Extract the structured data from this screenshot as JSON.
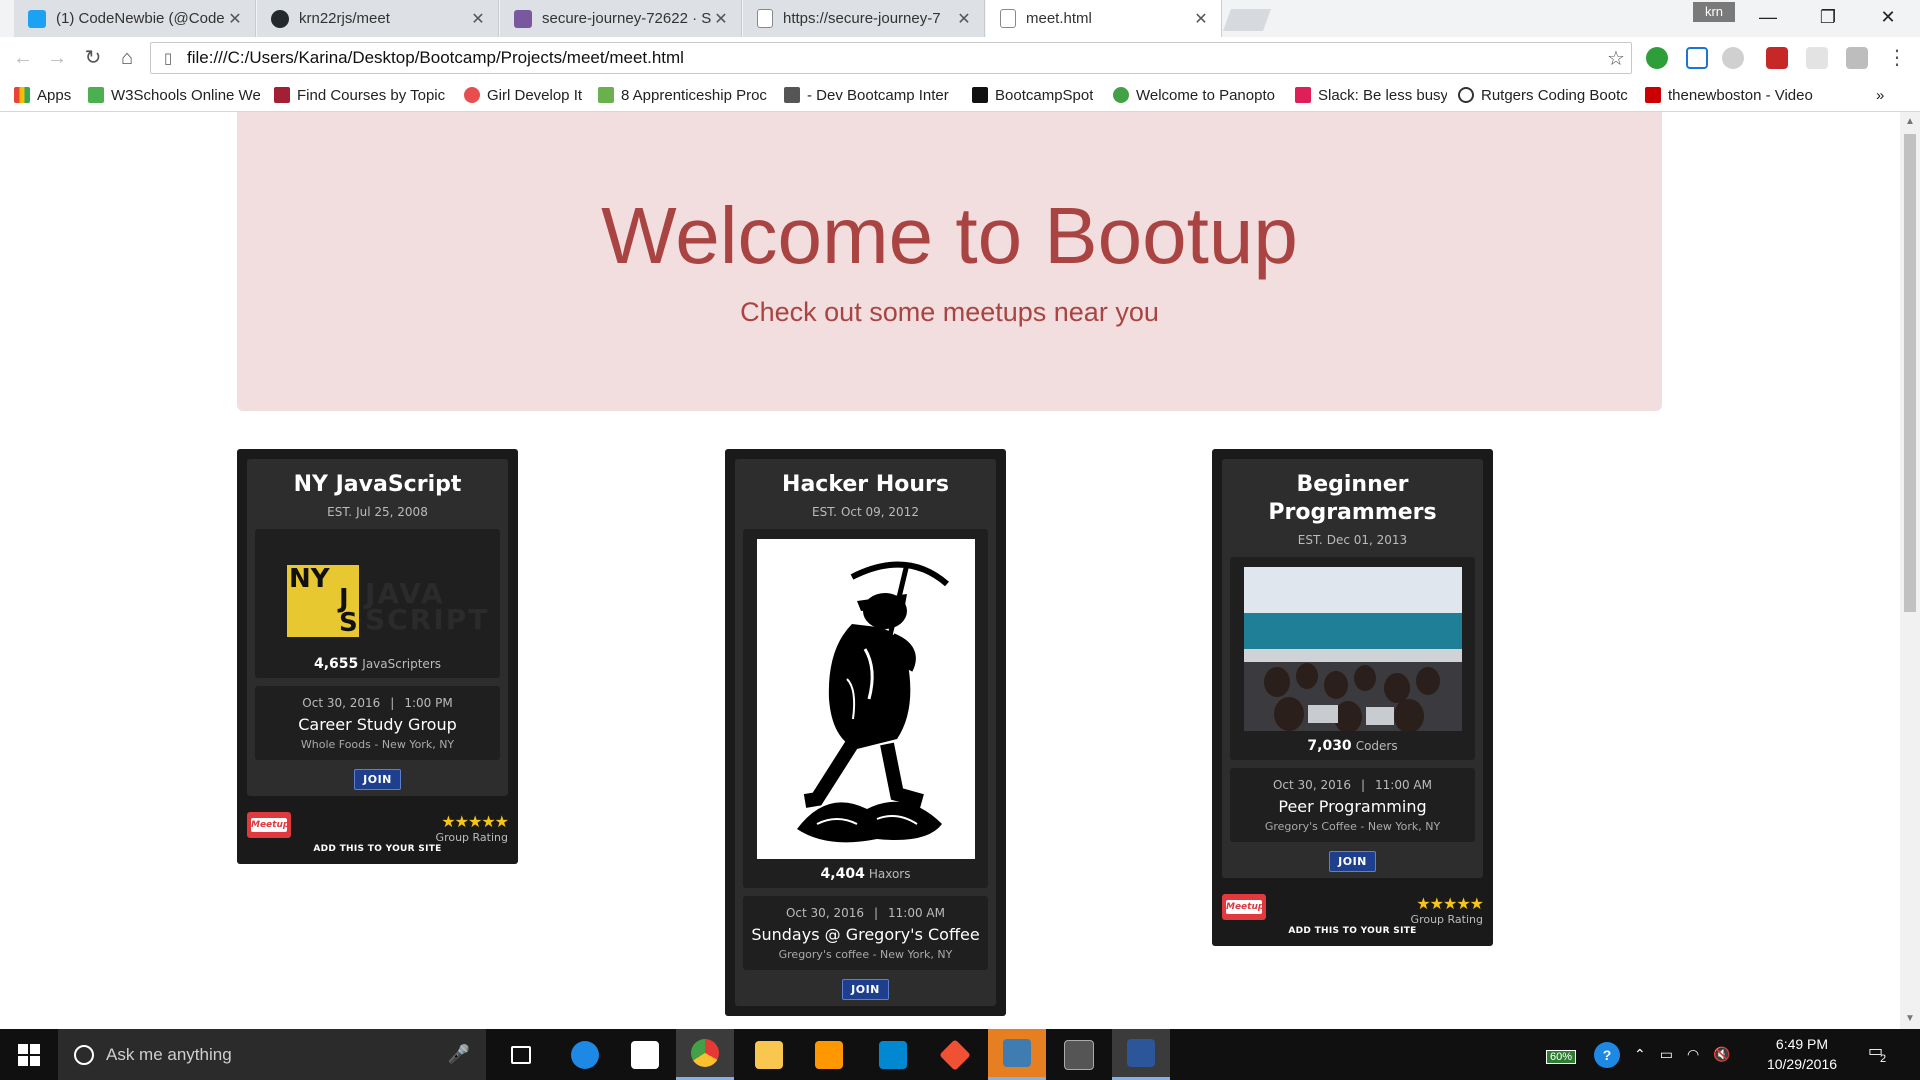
{
  "browser": {
    "tabs": [
      {
        "title": "(1) CodeNewbie (@Code",
        "icon_color": "#1da1f2",
        "icon": "twitter-icon"
      },
      {
        "title": "krn22rjs/meet",
        "icon_color": "#24292e",
        "icon": "github-icon"
      },
      {
        "title": "secure-journey-72622 · S",
        "icon_color": "#79589f",
        "icon": "heroku-icon"
      },
      {
        "title": "https://secure-journey-7",
        "icon_color": "#888888",
        "icon": "page-icon"
      },
      {
        "title": "meet.html",
        "icon_color": "#888888",
        "icon": "page-icon"
      }
    ],
    "user_badge": "krn",
    "url": "file:///C:/Users/Karina/Desktop/Bootcamp/Projects/meet/meet.html",
    "bookmarks": [
      {
        "label": "Apps",
        "color": "#4285f4"
      },
      {
        "label": "W3Schools Online We",
        "color": "#4caf50"
      },
      {
        "label": "Find Courses by Topic",
        "color": "#a31f34"
      },
      {
        "label": "Girl Develop It",
        "color": "#e94e4e"
      },
      {
        "label": "8 Apprenticeship Proc",
        "color": "#6ab04c"
      },
      {
        "label": "- Dev Bootcamp Inter",
        "color": "#555555"
      },
      {
        "label": "BootcampSpot",
        "color": "#111111"
      },
      {
        "label": "Welcome to Panopto",
        "color": "#43a047"
      },
      {
        "label": "Slack: Be less busy",
        "color": "#e01e5a"
      },
      {
        "label": "Rutgers Coding Bootc",
        "color": "#333333"
      },
      {
        "label": "thenewboston - Video",
        "color": "#cc0000"
      }
    ]
  },
  "page": {
    "jumbotron": {
      "title": "Welcome to Bootup",
      "subtitle": "Check out some meetups near you"
    },
    "cards": [
      {
        "name": "NY JavaScript",
        "est_label": "EST.",
        "est_date": "Jul 25, 2008",
        "logo_text_ny": "NY",
        "logo_text_j": "J",
        "logo_text_s": "S",
        "logo_ghost": "JAVA\nSCRIPT",
        "member_count": "4,655",
        "member_label": "JavaScripters",
        "event_date": "Oct 30, 2016",
        "event_sep": "|",
        "event_time": "1:00 PM",
        "event_name": "Career Study Group",
        "event_location": "Whole Foods - New York, NY",
        "join_label": "JOIN",
        "meetup_logo": "Meetup",
        "stars": "★★★★★",
        "rating_label": "Group Rating",
        "add_site": "ADD THIS TO YOUR SITE"
      },
      {
        "name": "Hacker Hours",
        "est_label": "EST.",
        "est_date": "Oct 09, 2012",
        "member_count": "4,404",
        "member_label": "Haxors",
        "event_date": "Oct 30, 2016",
        "event_sep": "|",
        "event_time": "11:00 AM",
        "event_name": "Sundays @ Gregory's Coffee",
        "event_location": "Gregory's coffee - New York, NY",
        "join_label": "JOIN"
      },
      {
        "name": "Beginner Programmers",
        "est_label": "EST.",
        "est_date": "Dec 01, 2013",
        "member_count": "7,030",
        "member_label": "Coders",
        "event_date": "Oct 30, 2016",
        "event_sep": "|",
        "event_time": "11:00 AM",
        "event_name": "Peer Programming",
        "event_location": "Gregory's Coffee - New York, NY",
        "join_label": "JOIN",
        "meetup_logo": "Meetup",
        "stars": "★★★★★",
        "rating_label": "Group Rating",
        "add_site": "ADD THIS TO YOUR SITE"
      }
    ]
  },
  "taskbar": {
    "search_placeholder": "Ask me anything",
    "battery": "60%",
    "time": "6:49 PM",
    "date": "10/29/2016",
    "notification_count": "2",
    "apps": [
      {
        "name": "task-view-icon",
        "color": "#ffffff"
      },
      {
        "name": "edge-icon",
        "color": "#1e88e5"
      },
      {
        "name": "store-icon",
        "color": "#ffffff"
      },
      {
        "name": "chrome-icon",
        "color": "#e53935"
      },
      {
        "name": "file-explorer-icon",
        "color": "#f9c74f"
      },
      {
        "name": "sublime-icon",
        "color": "#ff9800"
      },
      {
        "name": "remote-desktop-icon",
        "color": "#0288d1"
      },
      {
        "name": "git-icon",
        "color": "#f05033"
      },
      {
        "name": "mysql-workbench-icon",
        "color": "#3e7cb1"
      },
      {
        "name": "terminal-icon",
        "color": "#555555"
      },
      {
        "name": "word-icon",
        "color": "#2b579a"
      }
    ]
  }
}
